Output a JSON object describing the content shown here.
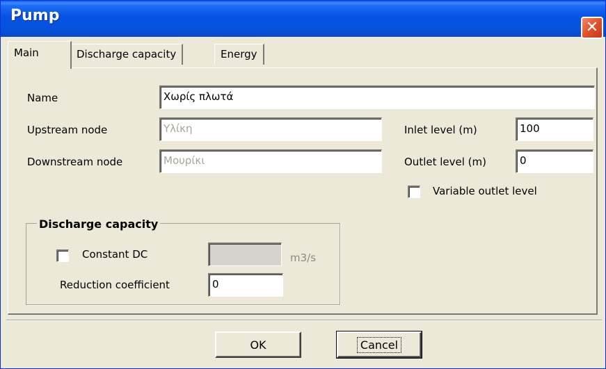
{
  "window": {
    "title": "Pump"
  },
  "tabs": [
    {
      "label": "Main"
    },
    {
      "label": "Discharge capacity"
    },
    {
      "label": "Energy"
    }
  ],
  "main": {
    "name_label": "Name",
    "name_value": "Χωρίς πλωτά",
    "upstream_label": "Upstream node",
    "upstream_value": "Υλίκη",
    "downstream_label": "Downstream node",
    "downstream_value": "Μουρίκι",
    "inlet_label": "Inlet level (m)",
    "inlet_value": "100",
    "outlet_label": "Outlet level (m)",
    "outlet_value": "0",
    "variable_outlet_label": "Variable outlet level"
  },
  "discharge": {
    "group_title": "Discharge capacity",
    "constant_label": "Constant DC",
    "constant_value": "",
    "unit": "m3/s",
    "reduction_label": "Reduction coefficient",
    "reduction_value": "0"
  },
  "buttons": {
    "ok": "OK",
    "cancel": "Cancel"
  },
  "icons": {
    "close": "close-icon"
  }
}
